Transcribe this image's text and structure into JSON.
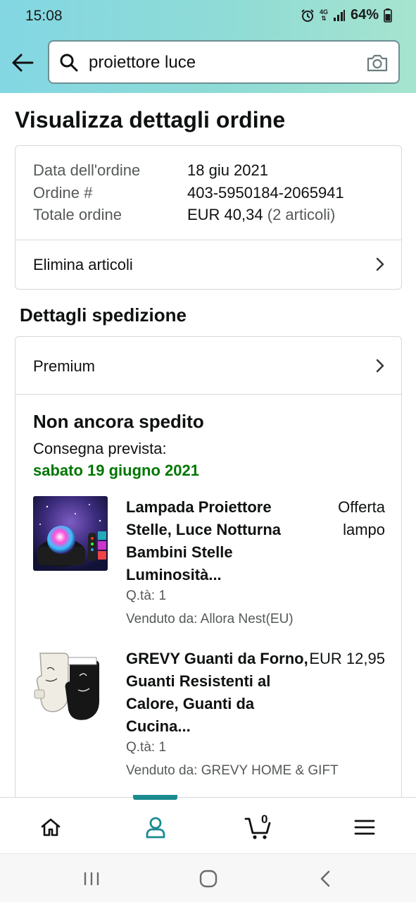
{
  "status_bar": {
    "time": "15:08",
    "network": "4G",
    "battery": "64%"
  },
  "search": {
    "query": "proiettore luce"
  },
  "page_title": "Visualizza dettagli ordine",
  "order": {
    "date_label": "Data dell'ordine",
    "date_value": "18 giu 2021",
    "number_label": "Ordine #",
    "number_value": "403-5950184-2065941",
    "total_label": "Totale ordine",
    "total_value": "EUR 40,34",
    "total_count": "(2 articoli)",
    "remove_items": "Elimina articoli"
  },
  "shipping": {
    "heading": "Dettagli spedizione",
    "method": "Premium",
    "status": "Non ancora spedito",
    "delivery_label": "Consegna prevista:",
    "delivery_date": "sabato 19 giugno 2021"
  },
  "items": [
    {
      "title": "Lampada Proiettore Stelle, Luce Notturna Bambini Stelle Luminosità...",
      "price": "Offerta lampo",
      "qty": "Q.tà: 1",
      "seller": "Venduto da: Allora Nest(EU)"
    },
    {
      "title": "GREVY Guanti da Forno, Guanti Resistenti al Calore, Guanti da Cucina...",
      "price": "EUR 12,95",
      "qty": "Q.tà: 1",
      "seller": "Venduto da: GREVY HOME & GIFT"
    }
  ],
  "bottom_nav": {
    "cart_count": "0"
  },
  "colors": {
    "accent": "#1b8a8f",
    "delivery_green": "#007600",
    "header_start": "#83d7e3",
    "header_end": "#a6e4cf"
  }
}
